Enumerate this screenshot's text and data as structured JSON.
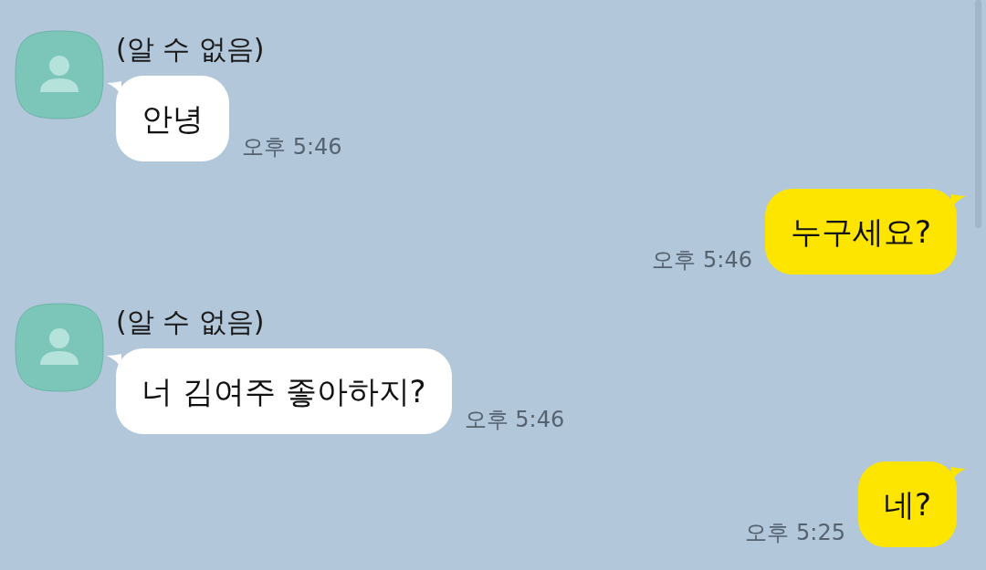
{
  "messages": [
    {
      "kind": "received",
      "sender": "(알 수 없음)",
      "text": "안녕",
      "time": "오후 5:46"
    },
    {
      "kind": "sent",
      "text": "누구세요?",
      "time": "오후 5:46"
    },
    {
      "kind": "received",
      "sender": "(알 수 없음)",
      "text": "너 김여주 좋아하지?",
      "time": "오후 5:46"
    },
    {
      "kind": "sent",
      "text": "네?",
      "time": "오후 5:25"
    }
  ]
}
